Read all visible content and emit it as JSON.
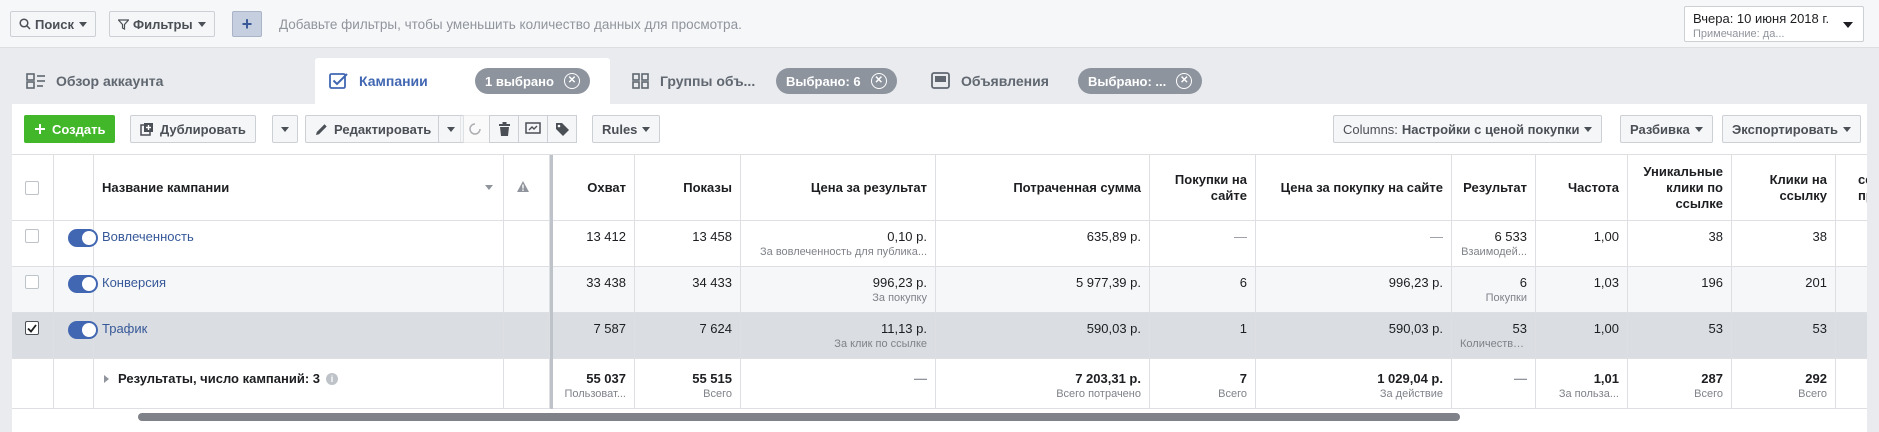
{
  "filterbar": {
    "search_label": "Поиск",
    "filters_label": "Фильтры",
    "add_label": "+",
    "hint": "Добавьте фильтры, чтобы уменьшить количество данных для просмотра.",
    "date_main": "Вчера: 10 июня 2018 г.",
    "date_sub": "Примечание: да..."
  },
  "tabs": {
    "overview": "Обзор аккаунта",
    "campaigns": "Кампании",
    "campaigns_pill": "1 выбрано",
    "adsets": "Группы объ...",
    "adsets_pill": "Выбрано: 6",
    "ads": "Объявления",
    "ads_pill": "Выбрано: ..."
  },
  "toolbar": {
    "create": "Создать",
    "duplicate": "Дублировать",
    "edit": "Редактировать",
    "rules": "Rules",
    "columns_label": "Columns:",
    "columns_value": "Настройки с ценой покупки",
    "breakdown": "Разбивка",
    "export": "Экспортировать"
  },
  "table": {
    "headers": {
      "name": "Название кампании",
      "reach": "Охват",
      "impressions": "Показы",
      "cost_per_result": "Цена за результат",
      "spent": "Потраченная сумма",
      "purchases": "Покупки на сайте",
      "cost_per_purchase": "Цена за покупку на сайте",
      "results": "Результат",
      "frequency": "Частота",
      "unique_clicks": "Уникальные клики по ссылке",
      "link_clicks": "Клики на ссылку",
      "next": "секу прос"
    },
    "rows": [
      {
        "name": "Вовлеченность",
        "checked": false,
        "reach": "13 412",
        "impressions": "13 458",
        "cpr": "0,10 р.",
        "cpr_sub": "За вовлеченность для публика...",
        "spent": "635,89 р.",
        "purchases": "—",
        "cpp": "—",
        "results": "6 533",
        "results_sub": "Взаимодей...",
        "frequency": "1,00",
        "unique_clicks": "38",
        "link_clicks": "38"
      },
      {
        "name": "Конверсия",
        "checked": false,
        "reach": "33 438",
        "impressions": "34 433",
        "cpr": "996,23 р.",
        "cpr_sub": "За покупку",
        "spent": "5 977,39 р.",
        "purchases": "6",
        "cpp": "996,23 р.",
        "results": "6",
        "results_sub": "Покупки",
        "frequency": "1,03",
        "unique_clicks": "196",
        "link_clicks": "201"
      },
      {
        "name": "Трафик",
        "checked": true,
        "reach": "7 587",
        "impressions": "7 624",
        "cpr": "11,13 р.",
        "cpr_sub": "За клик по ссылке",
        "spent": "590,03 р.",
        "purchases": "1",
        "cpp": "590,03 р.",
        "results": "53",
        "results_sub": "Количество...",
        "frequency": "1,00",
        "unique_clicks": "53",
        "link_clicks": "53"
      }
    ],
    "total": {
      "label": "Результаты, число кампаний: 3",
      "reach": "55 037",
      "reach_sub": "Пользоват...",
      "impressions": "55 515",
      "impressions_sub": "Всего",
      "cpr": "—",
      "spent": "7 203,31 р.",
      "spent_sub": "Всего потрачено",
      "purchases": "7",
      "purchases_sub": "Всего",
      "cpp": "1 029,04 р.",
      "cpp_sub": "За действие",
      "results": "—",
      "frequency": "1,01",
      "frequency_sub": "За польза...",
      "unique_clicks": "287",
      "unique_clicks_sub": "Всего",
      "link_clicks": "292",
      "link_clicks_sub": "Всего"
    }
  }
}
